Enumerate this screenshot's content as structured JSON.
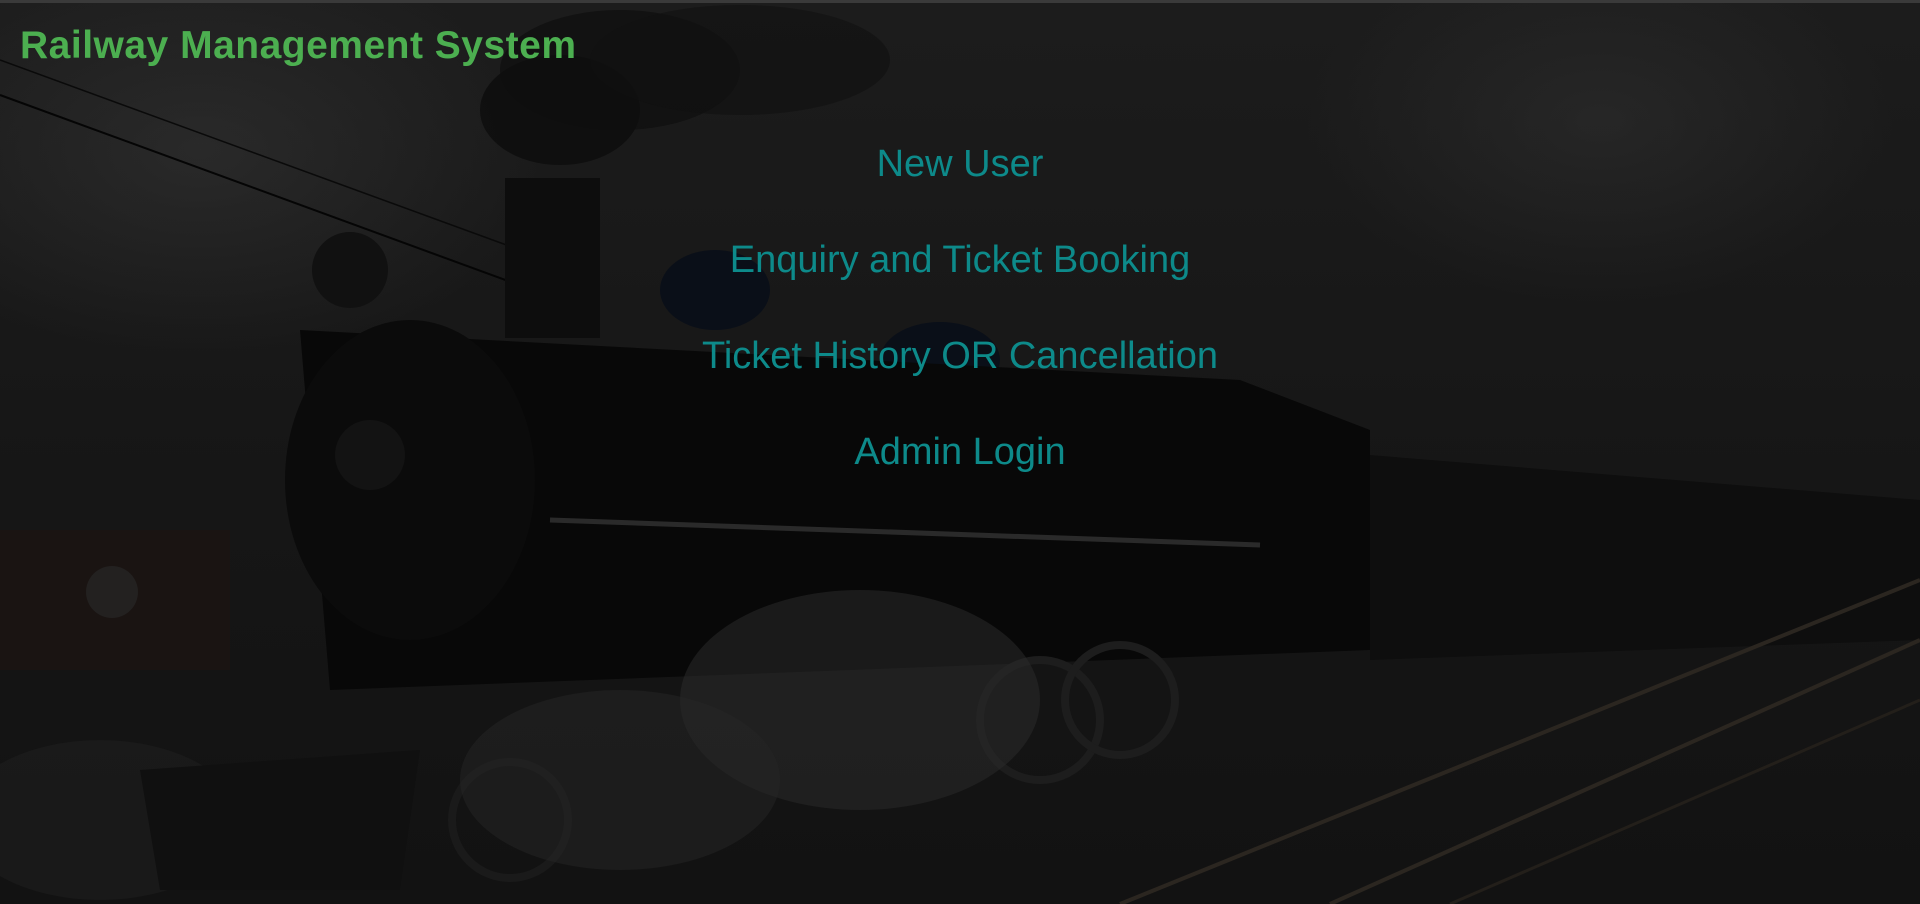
{
  "app": {
    "title": "Railway Management System"
  },
  "menu": {
    "items": [
      {
        "label": "New User"
      },
      {
        "label": "Enquiry and Ticket Booking"
      },
      {
        "label": "Ticket History OR Cancellation"
      },
      {
        "label": "Admin Login"
      }
    ]
  },
  "colors": {
    "title": "#4caf50",
    "menu_link": "#0d8a8a",
    "background": "#141414"
  }
}
